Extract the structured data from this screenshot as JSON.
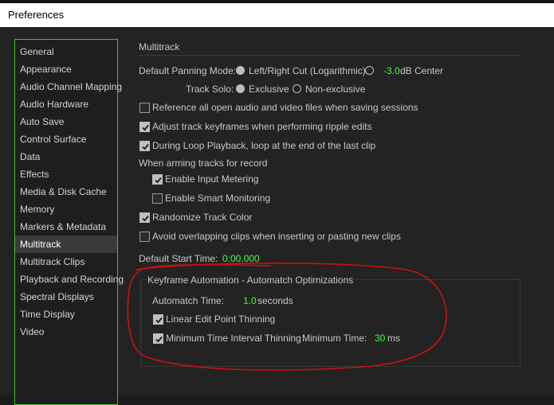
{
  "window": {
    "title": "Preferences"
  },
  "sidebar": {
    "items": [
      {
        "label": "General"
      },
      {
        "label": "Appearance"
      },
      {
        "label": "Audio Channel Mapping"
      },
      {
        "label": "Audio Hardware"
      },
      {
        "label": "Auto Save"
      },
      {
        "label": "Control Surface"
      },
      {
        "label": "Data"
      },
      {
        "label": "Effects"
      },
      {
        "label": "Media & Disk Cache"
      },
      {
        "label": "Memory"
      },
      {
        "label": "Markers & Metadata"
      },
      {
        "label": "Multitrack"
      },
      {
        "label": "Multitrack Clips"
      },
      {
        "label": "Playback and Recording"
      },
      {
        "label": "Spectral Displays"
      },
      {
        "label": "Time Display"
      },
      {
        "label": "Video"
      }
    ],
    "selected": "Multitrack"
  },
  "multitrack": {
    "section_title": "Multitrack",
    "panning": {
      "label": "Default Panning Mode:",
      "option1": "Left/Right Cut (Logarithmic)",
      "option2_value": "-3.0",
      "option2_unit": "dB Center"
    },
    "track_solo": {
      "label": "Track Solo:",
      "option1": "Exclusive",
      "option2": "Non-exclusive"
    },
    "checks": {
      "reference_open": {
        "label": "Reference all open audio and video files when saving sessions",
        "checked": false
      },
      "adjust_keyframes": {
        "label": "Adjust track keyframes when performing ripple edits",
        "checked": true
      },
      "loop_playback": {
        "label": "During Loop Playback, loop at the end of the last clip",
        "checked": true
      },
      "enable_metering": {
        "label": "Enable Input Metering",
        "checked": true
      },
      "smart_monitoring": {
        "label": "Enable Smart Monitoring",
        "checked": false
      },
      "randomize_color": {
        "label": "Randomize Track Color",
        "checked": true
      },
      "avoid_overlap": {
        "label": "Avoid overlapping clips when inserting or pasting new clips",
        "checked": false
      }
    },
    "arming_label": "When arming tracks for record",
    "default_start": {
      "label": "Default Start Time:",
      "value": "0:00.000"
    },
    "keyframe_group": {
      "title": "Keyframe Automation - Automatch Optimizations",
      "automatch_label": "Automatch Time:",
      "automatch_value": "1.0",
      "automatch_unit": "seconds",
      "linear_thinning": {
        "label": "Linear Edit Point Thinning",
        "checked": true
      },
      "min_interval": {
        "label": "Minimum Time Interval Thinning",
        "checked": true
      },
      "min_time_label": "Minimum Time:",
      "min_time_value": "30",
      "min_time_unit": "ms"
    }
  },
  "colors": {
    "accent_green": "#3cff3c",
    "sidebar_border": "#46c02c",
    "annotation_red": "#d01010"
  }
}
